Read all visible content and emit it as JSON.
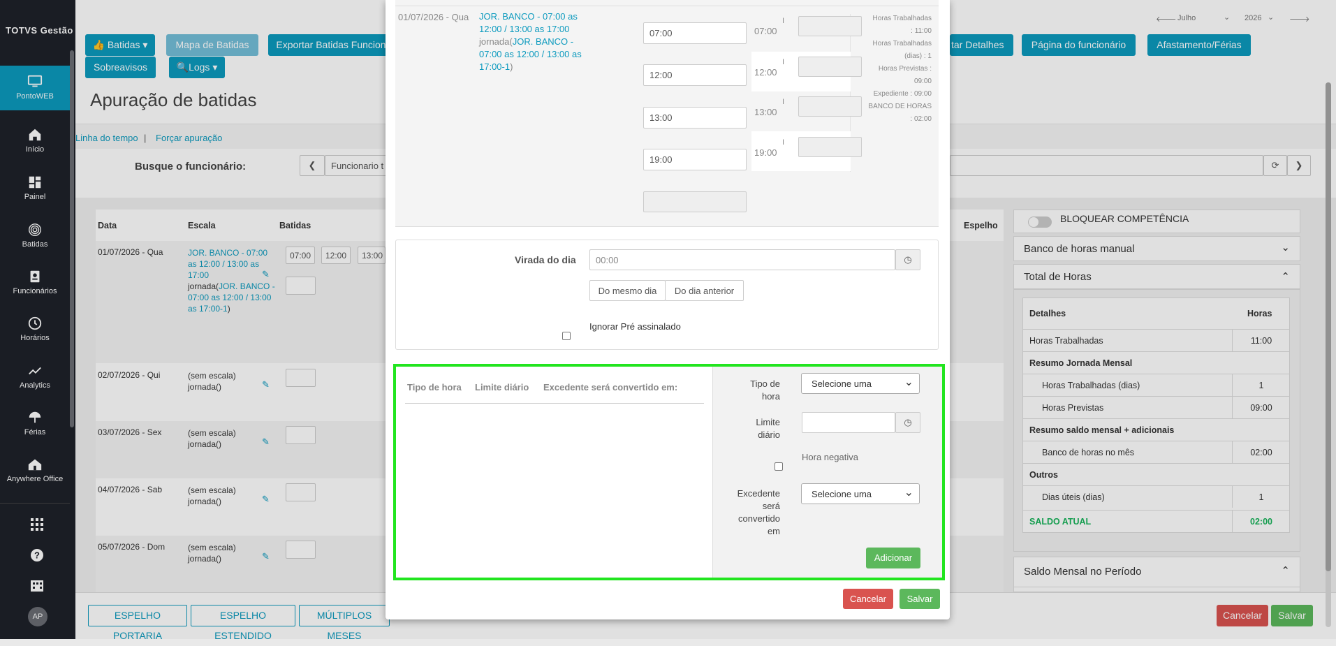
{
  "brand": "TOTVS Gestão",
  "sidebar": {
    "items": [
      {
        "label": "PontoWEB",
        "icon": "monitor-icon"
      },
      {
        "label": "Início",
        "icon": "home-icon"
      },
      {
        "label": "Painel",
        "icon": "dashboard-icon"
      },
      {
        "label": "Batidas",
        "icon": "fingerprint-icon"
      },
      {
        "label": "Funcionários",
        "icon": "badge-icon"
      },
      {
        "label": "Horários",
        "icon": "clock-icon"
      },
      {
        "label": "Analytics",
        "icon": "trend-icon"
      },
      {
        "label": "Férias",
        "icon": "umbrella-icon"
      },
      {
        "label": "Anywhere Office",
        "icon": "house-icon"
      }
    ],
    "avatar": "AP"
  },
  "period": {
    "month": "Julho",
    "year": "2026"
  },
  "toolbar": {
    "batidas": "Batidas",
    "mapa": "Mapa de Batidas",
    "exportar": "Exportar Batidas Funcion",
    "sobreavisos": "Sobreavisos",
    "logs": "Logs",
    "detalhes": "tar Detalhes",
    "pagina": "Página do funcionário",
    "afastamento": "Afastamento/Férias"
  },
  "page": {
    "title": "Apuração de batidas",
    "link1": "Linha do tempo",
    "sep": "|",
    "link2": "Forçar apuração",
    "search_label": "Busque o funcionário:",
    "search_value": "Funcionario t"
  },
  "table": {
    "headers": {
      "data": "Data",
      "escala": "Escala",
      "batidas": "Batidas",
      "espelho": "Espelho"
    },
    "rows": [
      {
        "date": "01/07/2026 - Qua",
        "escala_link": "JOR. BANCO - 07:00 as 12:00 / 13:00 as 17:00",
        "jornada_prefix": "jornada(",
        "jornada_link": "JOR. BANCO - 07:00 as 12:00 / 13:00 as 17:00-1",
        "jornada_suffix": ")",
        "b1": "07:00",
        "b2": "12:00",
        "b3": "13:00"
      },
      {
        "date": "02/07/2026 - Qui",
        "escala": "(sem escala)",
        "jornada": "jornada()"
      },
      {
        "date": "03/07/2026 - Sex",
        "escala": "(sem escala)",
        "jornada": "jornada()"
      },
      {
        "date": "04/07/2026 - Sab",
        "escala": "(sem escala)",
        "jornada": "jornada()"
      },
      {
        "date": "05/07/2026 - Dom",
        "escala": "(sem escala)",
        "jornada": "jornada()"
      }
    ]
  },
  "bottom": {
    "espelho_portaria": "ESPELHO PORTARIA",
    "espelho_estendido": "ESPELHO ESTENDIDO",
    "multiplos": "MÚLTIPLOS MESES",
    "cancelar": "Cancelar",
    "salvar": "Salvar"
  },
  "right": {
    "bloquear": "BLOQUEAR COMPETÊNCIA",
    "banco_manual": "Banco de horas manual",
    "total_horas": "Total de Horas",
    "detalhes": "Detalhes",
    "horas": "Horas",
    "rows": [
      {
        "label": "Horas Trabalhadas",
        "value": "11:00"
      },
      {
        "section": "Resumo Jornada Mensal"
      },
      {
        "label": "Horas Trabalhadas (dias)",
        "value": "1",
        "indent": true
      },
      {
        "label": "Horas Previstas",
        "value": "09:00",
        "indent": true
      },
      {
        "section": "Resumo saldo mensal + adicionais"
      },
      {
        "label": "Banco de horas no mês",
        "value": "02:00",
        "indent": true
      },
      {
        "section": "Outros"
      },
      {
        "label": "Dias úteis (dias)",
        "value": "1",
        "indent": true
      }
    ],
    "saldo_label": "SALDO ATUAL",
    "saldo_value": "02:00",
    "saldo_mensal": "Saldo Mensal no Período"
  },
  "modal": {
    "date": "01/07/2026 - Qua",
    "escala_link": "JOR. BANCO - 07:00 as 12:00 / 13:00 as 17:00",
    "jornada_prefix": "jornada(",
    "jornada_link": "JOR. BANCO - 07:00 as 12:00 / 13:00 as 17:00-1",
    "jornada_suffix": ")",
    "batidas": [
      "07:00",
      "12:00",
      "13:00",
      "19:00"
    ],
    "previstas": [
      "07:00",
      "12:00",
      "13:00",
      "19:00"
    ],
    "tick": "I",
    "info": {
      "l1": "Horas Trabalhadas",
      "l2": ": 11:00",
      "l3": "Horas Trabalhadas",
      "l4": "(dias) : 1",
      "l5": "Horas Previstas :",
      "l6": "09:00",
      "l7": "Expediente : 09:00",
      "l8": "BANCO DE HORAS",
      "l9": ": 02:00"
    },
    "virada_label": "Virada do dia",
    "virada_placeholder": "00:00",
    "mesmo_dia": "Do mesmo dia",
    "dia_anterior": "Do dia anterior",
    "ignorar": "Ignorar Pré assinalado",
    "col_tipo": "Tipo de hora",
    "col_limite": "Limite diário",
    "col_excedente": "Excedente será convertido em:",
    "tipo_label_1": "Tipo de",
    "tipo_label_2": "hora",
    "tipo_select": "Selecione uma",
    "limite_label_1": "Limite",
    "limite_label_2": "diário",
    "hora_negativa": "Hora negativa",
    "exc_label_1": "Excedente",
    "exc_label_2": "será",
    "exc_label_3": "convertido",
    "exc_label_4": "em",
    "exc_select": "Selecione uma",
    "adicionar": "Adicionar",
    "cancelar": "Cancelar",
    "salvar": "Salvar"
  },
  "colors": {
    "primary": "#0c9abe",
    "highlight": "#22e51f",
    "success": "#5cb85c",
    "danger": "#d9534f",
    "saldo": "#19b35a"
  }
}
